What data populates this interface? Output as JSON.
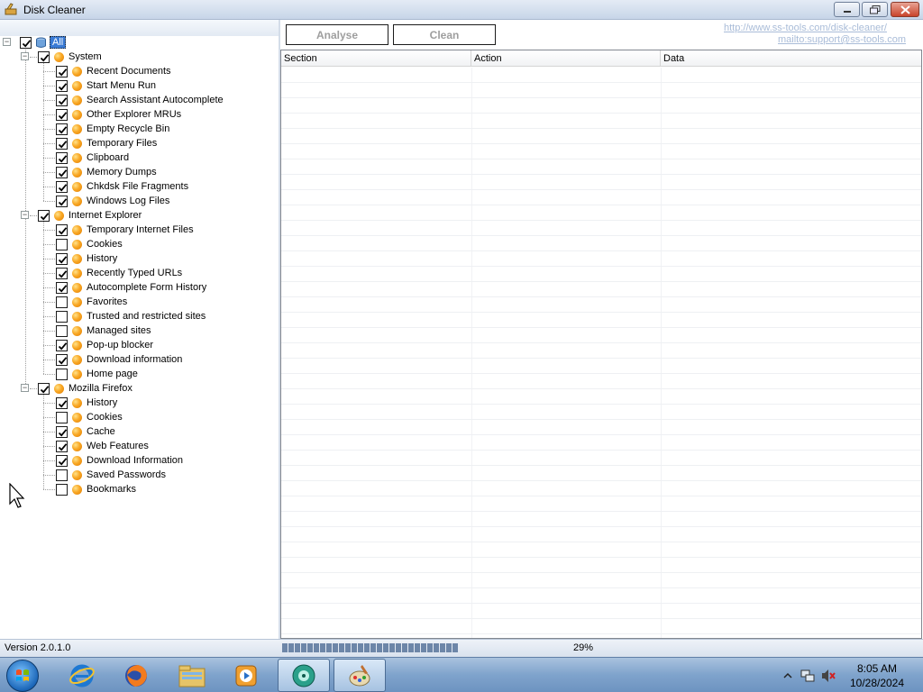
{
  "window": {
    "title": "Disk Cleaner"
  },
  "tree": {
    "root_label": "All",
    "groups": [
      {
        "label": "System",
        "checked": true,
        "items": [
          {
            "label": "Recent Documents",
            "checked": true
          },
          {
            "label": "Start Menu Run",
            "checked": true
          },
          {
            "label": "Search Assistant Autocomplete",
            "checked": true
          },
          {
            "label": "Other Explorer MRUs",
            "checked": true
          },
          {
            "label": "Empty Recycle Bin",
            "checked": true
          },
          {
            "label": "Temporary Files",
            "checked": true
          },
          {
            "label": "Clipboard",
            "checked": true
          },
          {
            "label": "Memory Dumps",
            "checked": true
          },
          {
            "label": "Chkdsk File Fragments",
            "checked": true
          },
          {
            "label": "Windows Log Files",
            "checked": true
          }
        ]
      },
      {
        "label": "Internet Explorer",
        "checked": true,
        "items": [
          {
            "label": "Temporary Internet Files",
            "checked": true
          },
          {
            "label": "Cookies",
            "checked": false
          },
          {
            "label": "History",
            "checked": true
          },
          {
            "label": "Recently Typed URLs",
            "checked": true
          },
          {
            "label": "Autocomplete Form History",
            "checked": true
          },
          {
            "label": "Favorites",
            "checked": false
          },
          {
            "label": "Trusted and restricted sites",
            "checked": false
          },
          {
            "label": "Managed sites",
            "checked": false
          },
          {
            "label": "Pop-up blocker",
            "checked": true
          },
          {
            "label": "Download information",
            "checked": true
          },
          {
            "label": "Home page",
            "checked": false
          }
        ]
      },
      {
        "label": "Mozilla Firefox",
        "checked": true,
        "items": [
          {
            "label": "History",
            "checked": true
          },
          {
            "label": "Cookies",
            "checked": false
          },
          {
            "label": "Cache",
            "checked": true
          },
          {
            "label": "Web Features",
            "checked": true
          },
          {
            "label": "Download Information",
            "checked": true
          },
          {
            "label": "Saved Passwords",
            "checked": false
          },
          {
            "label": "Bookmarks",
            "checked": false
          }
        ]
      }
    ]
  },
  "toolbar": {
    "analyse_label": "Analyse",
    "clean_label": "Clean",
    "links": [
      "http://www.ss-tools.com/disk-cleaner/",
      "mailto:support@ss-tools.com"
    ]
  },
  "grid": {
    "columns": [
      "Section",
      "Action",
      "Data"
    ]
  },
  "status": {
    "version": "Version 2.0.1.0",
    "progress_percent": 29,
    "progress_text": "29%"
  },
  "taskbar": {
    "apps": [
      "internet-explorer-icon",
      "firefox-icon",
      "file-explorer-icon",
      "media-player-icon",
      "disk-cleaner-app-icon",
      "paint-icon"
    ],
    "time": "8:05 AM",
    "date": "10/28/2024"
  },
  "colors": {
    "selection": "#3a7bd5",
    "dot": "#f9a825",
    "link": "#a9bcd8"
  }
}
